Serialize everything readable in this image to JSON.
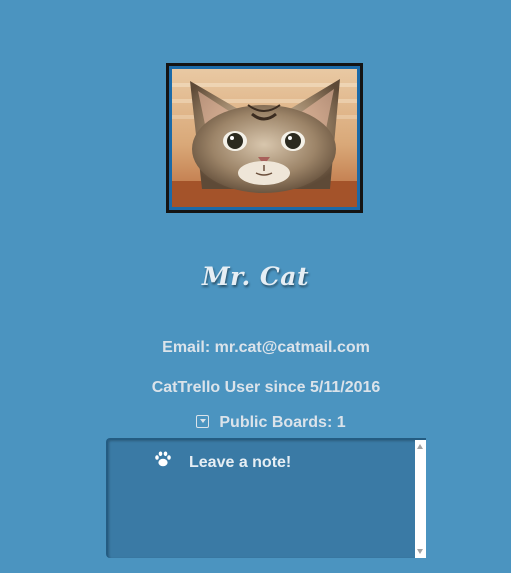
{
  "profile": {
    "name": "Mr. Cat",
    "email": "Email: mr.cat@catmail.com",
    "since": "CatTrello User since 5/11/2016",
    "public_boards": "Public Boards: 1"
  },
  "note": {
    "placeholder": "Leave a note!"
  },
  "colors": {
    "background": "#4b94c0",
    "note_box": "#3a7aa5",
    "text": "#dbe3ea"
  }
}
